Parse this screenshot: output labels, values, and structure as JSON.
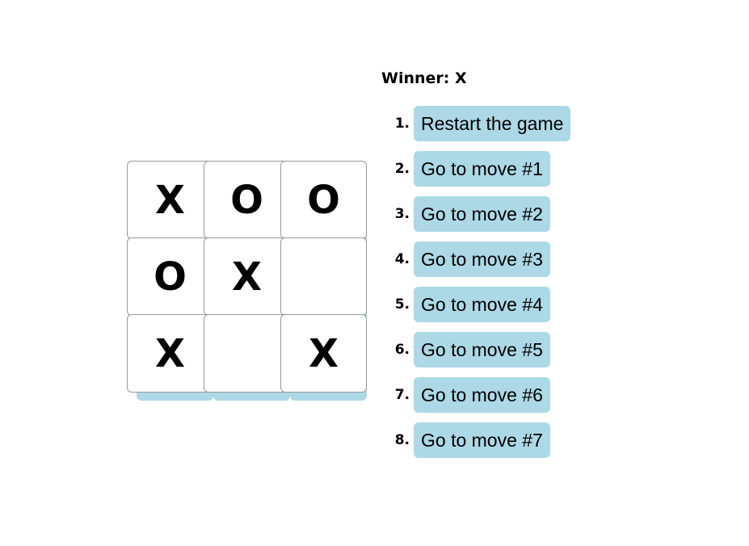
{
  "status": "Winner: X",
  "board": {
    "squares": [
      "X",
      "O",
      "O",
      "O",
      "X",
      "",
      "X",
      "",
      "X"
    ]
  },
  "moves": [
    {
      "number": "1.",
      "label": "Restart the game"
    },
    {
      "number": "2.",
      "label": "Go to move #1"
    },
    {
      "number": "3.",
      "label": "Go to move #2"
    },
    {
      "number": "4.",
      "label": "Go to move #3"
    },
    {
      "number": "5.",
      "label": "Go to move #4"
    },
    {
      "number": "6.",
      "label": "Go to move #5"
    },
    {
      "number": "7.",
      "label": "Go to move #6"
    },
    {
      "number": "8.",
      "label": "Go to move #7"
    }
  ],
  "colors": {
    "button_background": "#add8e6",
    "square_border": "#999999"
  }
}
